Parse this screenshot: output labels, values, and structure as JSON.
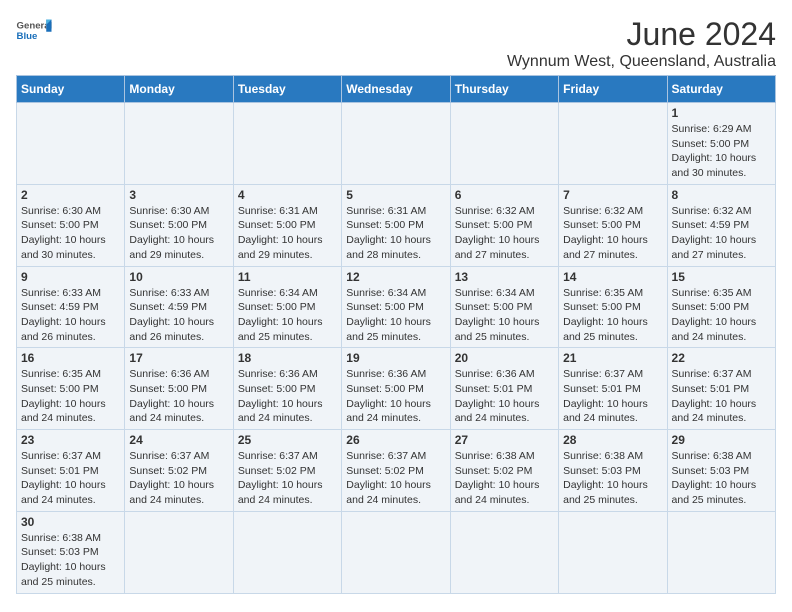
{
  "header": {
    "logo_general": "General",
    "logo_blue": "Blue",
    "month_title": "June 2024",
    "location": "Wynnum West, Queensland, Australia"
  },
  "weekdays": [
    "Sunday",
    "Monday",
    "Tuesday",
    "Wednesday",
    "Thursday",
    "Friday",
    "Saturday"
  ],
  "weeks": [
    [
      {
        "day": "",
        "info": ""
      },
      {
        "day": "",
        "info": ""
      },
      {
        "day": "",
        "info": ""
      },
      {
        "day": "",
        "info": ""
      },
      {
        "day": "",
        "info": ""
      },
      {
        "day": "",
        "info": ""
      },
      {
        "day": "1",
        "info": "Sunrise: 6:29 AM\nSunset: 5:00 PM\nDaylight: 10 hours and 30 minutes."
      }
    ],
    [
      {
        "day": "2",
        "info": "Sunrise: 6:30 AM\nSunset: 5:00 PM\nDaylight: 10 hours and 30 minutes."
      },
      {
        "day": "3",
        "info": "Sunrise: 6:30 AM\nSunset: 5:00 PM\nDaylight: 10 hours and 29 minutes."
      },
      {
        "day": "4",
        "info": "Sunrise: 6:31 AM\nSunset: 5:00 PM\nDaylight: 10 hours and 29 minutes."
      },
      {
        "day": "5",
        "info": "Sunrise: 6:31 AM\nSunset: 5:00 PM\nDaylight: 10 hours and 28 minutes."
      },
      {
        "day": "6",
        "info": "Sunrise: 6:32 AM\nSunset: 5:00 PM\nDaylight: 10 hours and 27 minutes."
      },
      {
        "day": "7",
        "info": "Sunrise: 6:32 AM\nSunset: 5:00 PM\nDaylight: 10 hours and 27 minutes."
      },
      {
        "day": "8",
        "info": "Sunrise: 6:32 AM\nSunset: 4:59 PM\nDaylight: 10 hours and 27 minutes."
      }
    ],
    [
      {
        "day": "9",
        "info": "Sunrise: 6:33 AM\nSunset: 4:59 PM\nDaylight: 10 hours and 26 minutes."
      },
      {
        "day": "10",
        "info": "Sunrise: 6:33 AM\nSunset: 4:59 PM\nDaylight: 10 hours and 26 minutes."
      },
      {
        "day": "11",
        "info": "Sunrise: 6:34 AM\nSunset: 5:00 PM\nDaylight: 10 hours and 25 minutes."
      },
      {
        "day": "12",
        "info": "Sunrise: 6:34 AM\nSunset: 5:00 PM\nDaylight: 10 hours and 25 minutes."
      },
      {
        "day": "13",
        "info": "Sunrise: 6:34 AM\nSunset: 5:00 PM\nDaylight: 10 hours and 25 minutes."
      },
      {
        "day": "14",
        "info": "Sunrise: 6:35 AM\nSunset: 5:00 PM\nDaylight: 10 hours and 25 minutes."
      },
      {
        "day": "15",
        "info": "Sunrise: 6:35 AM\nSunset: 5:00 PM\nDaylight: 10 hours and 24 minutes."
      }
    ],
    [
      {
        "day": "16",
        "info": "Sunrise: 6:35 AM\nSunset: 5:00 PM\nDaylight: 10 hours and 24 minutes."
      },
      {
        "day": "17",
        "info": "Sunrise: 6:36 AM\nSunset: 5:00 PM\nDaylight: 10 hours and 24 minutes."
      },
      {
        "day": "18",
        "info": "Sunrise: 6:36 AM\nSunset: 5:00 PM\nDaylight: 10 hours and 24 minutes."
      },
      {
        "day": "19",
        "info": "Sunrise: 6:36 AM\nSunset: 5:00 PM\nDaylight: 10 hours and 24 minutes."
      },
      {
        "day": "20",
        "info": "Sunrise: 6:36 AM\nSunset: 5:01 PM\nDaylight: 10 hours and 24 minutes."
      },
      {
        "day": "21",
        "info": "Sunrise: 6:37 AM\nSunset: 5:01 PM\nDaylight: 10 hours and 24 minutes."
      },
      {
        "day": "22",
        "info": "Sunrise: 6:37 AM\nSunset: 5:01 PM\nDaylight: 10 hours and 24 minutes."
      }
    ],
    [
      {
        "day": "23",
        "info": "Sunrise: 6:37 AM\nSunset: 5:01 PM\nDaylight: 10 hours and 24 minutes."
      },
      {
        "day": "24",
        "info": "Sunrise: 6:37 AM\nSunset: 5:02 PM\nDaylight: 10 hours and 24 minutes."
      },
      {
        "day": "25",
        "info": "Sunrise: 6:37 AM\nSunset: 5:02 PM\nDaylight: 10 hours and 24 minutes."
      },
      {
        "day": "26",
        "info": "Sunrise: 6:37 AM\nSunset: 5:02 PM\nDaylight: 10 hours and 24 minutes."
      },
      {
        "day": "27",
        "info": "Sunrise: 6:38 AM\nSunset: 5:02 PM\nDaylight: 10 hours and 24 minutes."
      },
      {
        "day": "28",
        "info": "Sunrise: 6:38 AM\nSunset: 5:03 PM\nDaylight: 10 hours and 25 minutes."
      },
      {
        "day": "29",
        "info": "Sunrise: 6:38 AM\nSunset: 5:03 PM\nDaylight: 10 hours and 25 minutes."
      }
    ],
    [
      {
        "day": "30",
        "info": "Sunrise: 6:38 AM\nSunset: 5:03 PM\nDaylight: 10 hours and 25 minutes."
      },
      {
        "day": "",
        "info": ""
      },
      {
        "day": "",
        "info": ""
      },
      {
        "day": "",
        "info": ""
      },
      {
        "day": "",
        "info": ""
      },
      {
        "day": "",
        "info": ""
      },
      {
        "day": "",
        "info": ""
      }
    ]
  ]
}
